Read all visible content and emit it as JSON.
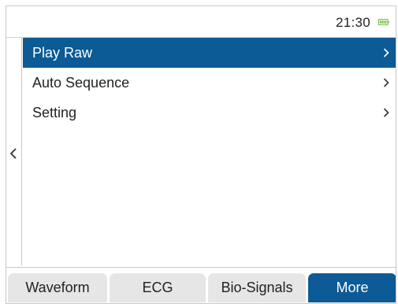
{
  "status_bar": {
    "time": "21:30",
    "battery_icon": "battery-full-icon",
    "battery_color": "#6fbf3c"
  },
  "navigation": {
    "back_icon": "chevron-left-icon"
  },
  "menu": {
    "items": [
      {
        "label": "Play Raw",
        "selected": true,
        "icon": "chevron-right-icon"
      },
      {
        "label": "Auto Sequence",
        "selected": false,
        "icon": "chevron-right-icon"
      },
      {
        "label": "Setting",
        "selected": false,
        "icon": "chevron-right-icon"
      }
    ],
    "selected_color": "#0c5a96"
  },
  "tabs": [
    {
      "label": "Waveform",
      "active": false
    },
    {
      "label": "ECG",
      "active": false
    },
    {
      "label": "Bio-Signals",
      "active": false
    },
    {
      "label": "More",
      "active": true
    }
  ],
  "colors": {
    "accent": "#0c5a96",
    "tab_inactive": "#e6e6e6",
    "border": "#c8c8c8"
  }
}
